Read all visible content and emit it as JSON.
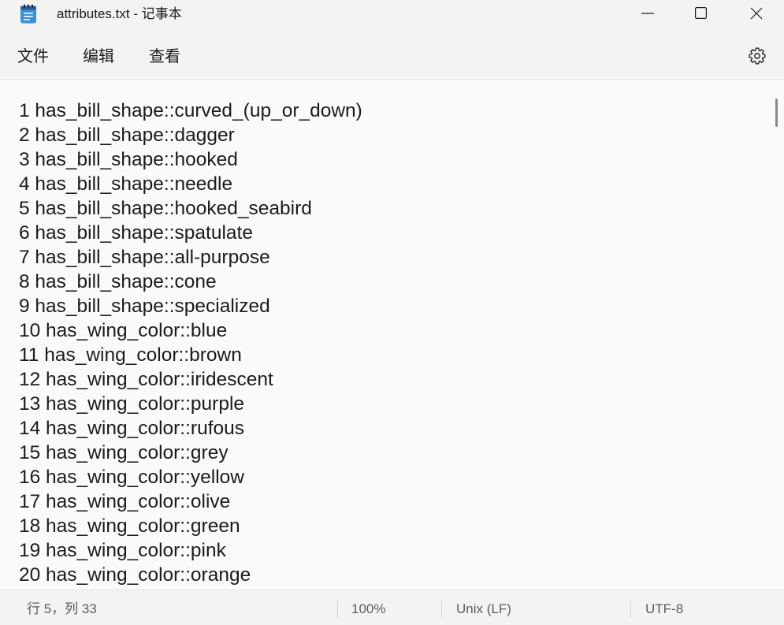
{
  "window": {
    "title": "attributes.txt - 记事本",
    "app_icon": "notepad-icon",
    "minimize_icon": "minimize-icon",
    "maximize_icon": "maximize-icon",
    "close_icon": "close-icon"
  },
  "menu": {
    "items": [
      {
        "label": "文件"
      },
      {
        "label": "编辑"
      },
      {
        "label": "查看"
      }
    ],
    "settings_icon": "gear-icon"
  },
  "editor": {
    "lines": [
      "1 has_bill_shape::curved_(up_or_down)",
      "2 has_bill_shape::dagger",
      "3 has_bill_shape::hooked",
      "4 has_bill_shape::needle",
      "5 has_bill_shape::hooked_seabird",
      "6 has_bill_shape::spatulate",
      "7 has_bill_shape::all-purpose",
      "8 has_bill_shape::cone",
      "9 has_bill_shape::specialized",
      "10 has_wing_color::blue",
      "11 has_wing_color::brown",
      "12 has_wing_color::iridescent",
      "13 has_wing_color::purple",
      "14 has_wing_color::rufous",
      "15 has_wing_color::grey",
      "16 has_wing_color::yellow",
      "17 has_wing_color::olive",
      "18 has_wing_color::green",
      "19 has_wing_color::pink",
      "20 has_wing_color::orange"
    ]
  },
  "status_bar": {
    "cursor_position": "行 5，列 33",
    "zoom": "100%",
    "line_ending": "Unix (LF)",
    "encoding": "UTF-8"
  },
  "colors": {
    "chrome_background": "#f3f3f3",
    "editor_background": "#fafafa",
    "divider": "#e3e3e3",
    "text": "#1b1b1b",
    "status_text": "#5c5c5c",
    "scrollbar_thumb": "#898989",
    "app_icon_blue": "#3c8fd9",
    "app_icon_dark": "#1e5fa8"
  }
}
